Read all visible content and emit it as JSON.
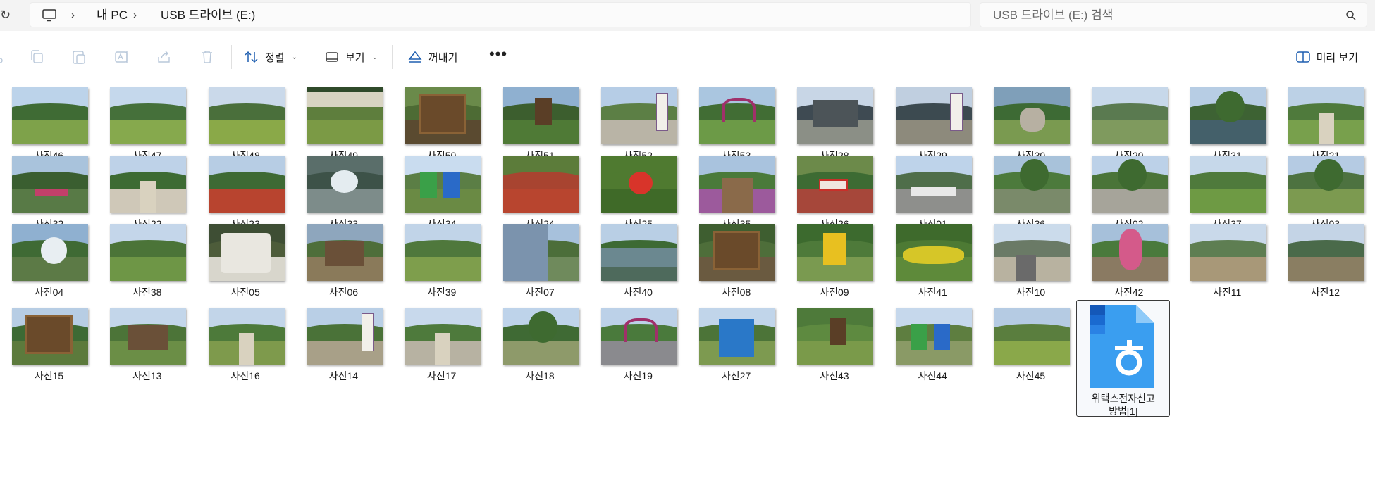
{
  "address": {
    "crumbs": [
      "내 PC",
      "USB 드라이브 (E:)"
    ],
    "search_placeholder": "USB 드라이브 (E:) 검색"
  },
  "toolbar": {
    "sort_label": "정렬",
    "view_label": "보기",
    "eject_label": "꺼내기",
    "more_label": "•••",
    "preview_label": "미리 보기"
  },
  "files": [
    {
      "name": "사진46",
      "sky": "#bcd3ea",
      "hill": "#3f6b34",
      "ground": "#7ea24a",
      "obj": ""
    },
    {
      "name": "사진47",
      "sky": "#c5d8ec",
      "hill": "#45703a",
      "ground": "#86a94d",
      "obj": ""
    },
    {
      "name": "사진48",
      "sky": "#cad9ea",
      "hill": "#4a6f3b",
      "ground": "#8aa948",
      "obj": ""
    },
    {
      "name": "사진49",
      "sky": "#2f4a2a",
      "hill": "#5e7e3d",
      "ground": "#7b9a45",
      "obj": "sign49"
    },
    {
      "name": "사진50",
      "sky": "#6a8a4a",
      "hill": "#4d6b34",
      "ground": "#5a4a30",
      "obj": "board"
    },
    {
      "name": "사진51",
      "sky": "#8fb0d0",
      "hill": "#3c5e2e",
      "ground": "#4f7a36",
      "obj": "post"
    },
    {
      "name": "사진52",
      "sky": "#b6cde6",
      "hill": "#5c7f45",
      "ground": "#b9b4a6",
      "obj": "signpost"
    },
    {
      "name": "사진53",
      "sky": "#aac6e0",
      "hill": "#416d34",
      "ground": "#6c9a47",
      "obj": "arch"
    },
    {
      "name": "사진28",
      "sky": "#c8d6e6",
      "hill": "#3e4a52",
      "ground": "#8b8f86",
      "obj": "house"
    },
    {
      "name": "사진29",
      "sky": "#c0cfe0",
      "hill": "#3c4a50",
      "ground": "#8d8a7c",
      "obj": "signpost"
    },
    {
      "name": "사진30",
      "sky": "#7f9fb9",
      "hill": "#3d6a34",
      "ground": "#7a9a50",
      "obj": "stone"
    },
    {
      "name": "사진20",
      "sky": "#c7d8ea",
      "hill": "#5a7a50",
      "ground": "#7f9a5e",
      "obj": ""
    },
    {
      "name": "사진31",
      "sky": "#b7cde4",
      "hill": "#3d6233",
      "ground": "#44606a",
      "obj": "tree"
    },
    {
      "name": "사진21",
      "sky": "#bcd1e6",
      "hill": "#4f7a3c",
      "ground": "#78a04c",
      "obj": "path"
    },
    {
      "name": "사진32",
      "sky": "#a9c3dc",
      "hill": "#3a5e30",
      "ground": "#587a46",
      "obj": "bench"
    },
    {
      "name": "사진22",
      "sky": "#bed2e8",
      "hill": "#3d6b33",
      "ground": "#cfc8b8",
      "obj": "path"
    },
    {
      "name": "사진23",
      "sky": "#b7cde4",
      "hill": "#3e6a34",
      "ground": "#b8442f",
      "obj": ""
    },
    {
      "name": "사진33",
      "sky": "#5a6e6a",
      "hill": "#3d5248",
      "ground": "#7d8c8a",
      "obj": "fountain"
    },
    {
      "name": "사진34",
      "sky": "#c9dcef",
      "hill": "#5b7e45",
      "ground": "#6a8a44",
      "obj": "chairs"
    },
    {
      "name": "사진24",
      "sky": "#5c7c3a",
      "hill": "#a84430",
      "ground": "#b8452f",
      "obj": ""
    },
    {
      "name": "사진25",
      "sky": "#4f7a30",
      "hill": "#4f7a30",
      "ground": "#3f6a28",
      "obj": "poppy"
    },
    {
      "name": "사진35",
      "sky": "#a9c3de",
      "hill": "#4a7a3a",
      "ground": "#9c5a9c",
      "obj": "bridge"
    },
    {
      "name": "사진26",
      "sky": "#6c8a4a",
      "hill": "#3d6b33",
      "ground": "#a6473a",
      "obj": "redsign"
    },
    {
      "name": "사진01",
      "sky": "#bed3ea",
      "hill": "#4f6e4a",
      "ground": "#8e8f8c",
      "obj": "cars"
    },
    {
      "name": "사진36",
      "sky": "#a8c2da",
      "hill": "#4c7a3c",
      "ground": "#7a8a6a",
      "obj": "tree"
    },
    {
      "name": "사진02",
      "sky": "#bcd1e8",
      "hill": "#4a7438",
      "ground": "#a6a49a",
      "obj": "tree"
    },
    {
      "name": "사진37",
      "sky": "#c6d8ea",
      "hill": "#4f7a3c",
      "ground": "#6e9a44",
      "obj": ""
    },
    {
      "name": "사진03",
      "sky": "#b5cbe3",
      "hill": "#4d7240",
      "ground": "#7c9a50",
      "obj": "tree"
    },
    {
      "name": "사진04",
      "sky": "#8fb0d0",
      "hill": "#3f6a34",
      "ground": "#5c7a46",
      "obj": "ball"
    },
    {
      "name": "사진38",
      "sky": "#c4d6ea",
      "hill": "#4b7438",
      "ground": "#6e9646",
      "obj": ""
    },
    {
      "name": "사진05",
      "sky": "#3e4e34",
      "hill": "#4d5c3a",
      "ground": "#d8d6cc",
      "obj": "plaque"
    },
    {
      "name": "사진06",
      "sky": "#8ea6bd",
      "hill": "#4e6e3a",
      "ground": "#8a7a5a",
      "obj": "hut"
    },
    {
      "name": "사진39",
      "sky": "#c1d4e8",
      "hill": "#4f783c",
      "ground": "#7e9e4c",
      "obj": ""
    },
    {
      "name": "사진07",
      "sky": "#a7c1dc",
      "hill": "#4c6e3a",
      "ground": "#6f8a5c",
      "obj": "mural"
    },
    {
      "name": "사진40",
      "sky": "#b9cfe5",
      "hill": "#3d6a34",
      "ground": "#4e6a5c",
      "obj": "pond"
    },
    {
      "name": "사진08",
      "sky": "#3e5e30",
      "hill": "#4e6e3a",
      "ground": "#6a5a40",
      "obj": "board"
    },
    {
      "name": "사진09",
      "sky": "#3c6a2e",
      "hill": "#4e7a3a",
      "ground": "#7a9a50",
      "obj": "yellowbox"
    },
    {
      "name": "사진41",
      "sky": "#3e6a2c",
      "hill": "#4d7a34",
      "ground": "#5e8a3a",
      "obj": "flowers"
    },
    {
      "name": "사진10",
      "sky": "#cbdbeb",
      "hill": "#6a7a66",
      "ground": "#b8b2a0",
      "obj": "dock"
    },
    {
      "name": "사진42",
      "sky": "#a6c0da",
      "hill": "#4a7a3c",
      "ground": "#8a7a62",
      "obj": "rabbit"
    },
    {
      "name": "사진11",
      "sky": "#c9d9ea",
      "hill": "#5e7e52",
      "ground": "#a89878",
      "obj": ""
    },
    {
      "name": "사진12",
      "sky": "#c4d4e6",
      "hill": "#4a6a4a",
      "ground": "#8a7e62",
      "obj": ""
    },
    {
      "name": "사진15",
      "sky": "#b7cde4",
      "hill": "#3d6a34",
      "ground": "#5c7a3c",
      "obj": "board"
    },
    {
      "name": "사진13",
      "sky": "#c3d6ea",
      "hill": "#4c7438",
      "ground": "#6b8e46",
      "obj": "hut"
    },
    {
      "name": "사진16",
      "sky": "#c2d5e9",
      "hill": "#4d7a3a",
      "ground": "#7e9a4c",
      "obj": "path"
    },
    {
      "name": "사진14",
      "sky": "#b9cfe6",
      "hill": "#4a7238",
      "ground": "#a8a088",
      "obj": "signpost"
    },
    {
      "name": "사진17",
      "sky": "#c8d9ec",
      "hill": "#4e7a3c",
      "ground": "#b7b2a2",
      "obj": "path"
    },
    {
      "name": "사진18",
      "sky": "#bed3ea",
      "hill": "#3f6a34",
      "ground": "#8e9a6a",
      "obj": "tree"
    },
    {
      "name": "사진19",
      "sky": "#bcd1e8",
      "hill": "#4a7a3c",
      "ground": "#8a8a8e",
      "obj": "arch"
    },
    {
      "name": "사진27",
      "sky": "#c1d5ea",
      "hill": "#4c7438",
      "ground": "#7d9a50",
      "obj": "gate"
    },
    {
      "name": "사진43",
      "sky": "#4e7a3a",
      "hill": "#5e8a40",
      "ground": "#7a9a4a",
      "obj": "post"
    },
    {
      "name": "사진44",
      "sky": "#c6d8ec",
      "hill": "#5e7e40",
      "ground": "#8a9a66",
      "obj": "chairs"
    },
    {
      "name": "사진45",
      "sky": "#b5cbe3",
      "hill": "#5a7e3e",
      "ground": "#8aa84a",
      "obj": ""
    },
    {
      "name": "위택스전자신고방법[1]",
      "doc": true,
      "label_line1": "위택스전자신고",
      "label_line2": "방법[1]"
    }
  ]
}
